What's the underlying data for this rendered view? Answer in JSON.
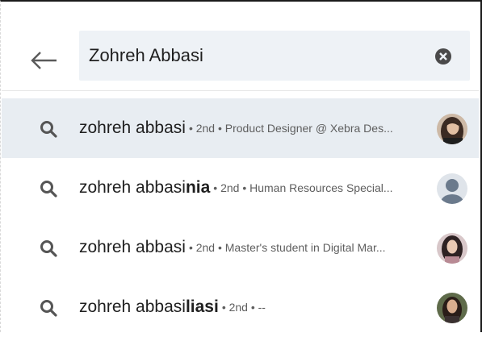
{
  "search": {
    "query": "Zohreh Abbasi",
    "back_icon": "arrow-left-icon",
    "clear_icon": "clear-circle-icon"
  },
  "results": [
    {
      "name": "zohreh abbasi",
      "name_suffix": "",
      "meta": "• 2nd • Product Designer @ Xebra Des...",
      "avatar": "avatar-photo-woman-1",
      "highlighted": true
    },
    {
      "name": "zohreh abbasi",
      "name_suffix": "nia",
      "meta": "• 2nd • Human Resources Special...",
      "avatar": "avatar-placeholder-silhouette",
      "highlighted": false
    },
    {
      "name": "zohreh abbasi",
      "name_suffix": "",
      "meta": "• 2nd • Master's student in Digital Mar...",
      "avatar": "avatar-photo-woman-2",
      "highlighted": false
    },
    {
      "name": "zohreh abbasi ",
      "name_suffix": "liasi",
      "meta": "• 2nd • --",
      "avatar": "avatar-photo-woman-3",
      "highlighted": false
    }
  ],
  "colors": {
    "highlight_row": "#e8edf2",
    "search_box": "#eef2f6",
    "icon_gray": "#555555"
  }
}
